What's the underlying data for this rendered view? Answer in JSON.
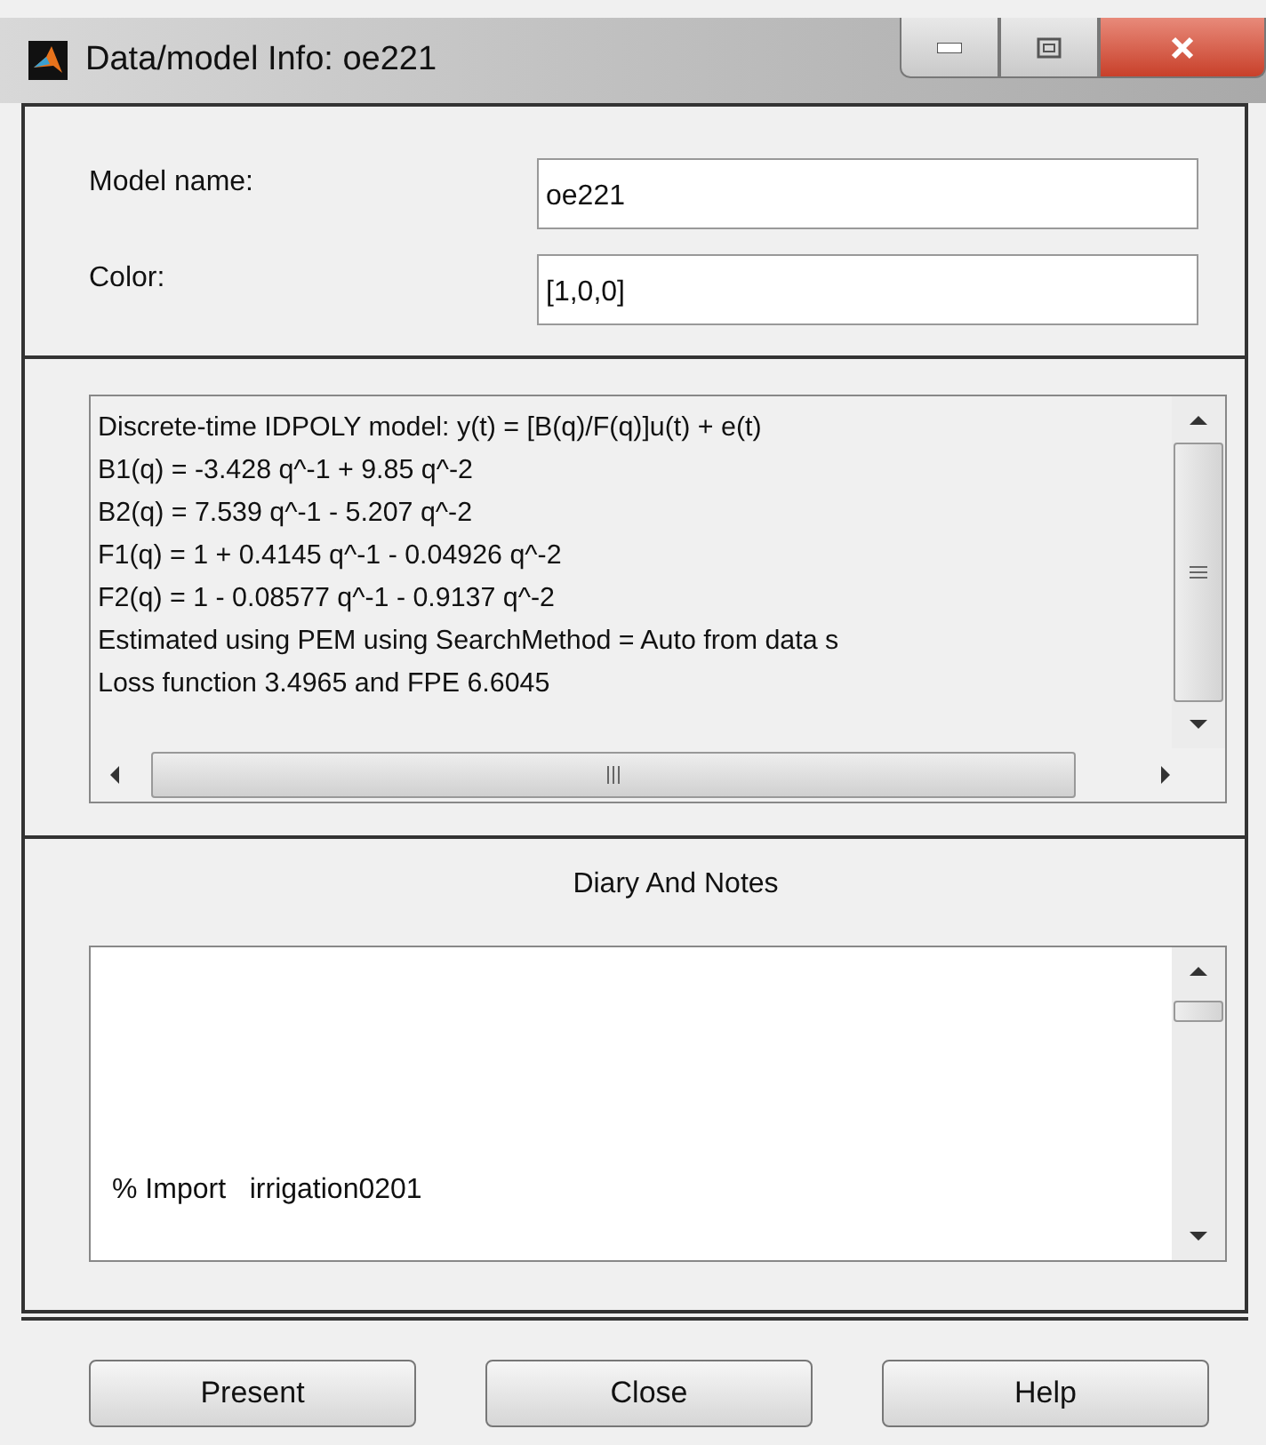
{
  "window": {
    "title": "Data/model Info: oe221"
  },
  "fields": [
    {
      "label": "Model name:",
      "value": "oe221"
    },
    {
      "label": "Color:",
      "value": "[1,0,0]"
    }
  ],
  "info_lines": [
    "Discrete-time IDPOLY model: y(t) = [B(q)/F(q)]u(t) + e(t)",
    "B1(q) = -3.428 q^-1 + 9.85 q^-2",
    "B2(q) = 7.539 q^-1 - 5.207 q^-2",
    "F1(q) = 1 + 0.4145 q^-1 - 0.04926 q^-2",
    "F2(q) = 1 - 0.08577 q^-1 - 0.9137 q^-2",
    "Estimated using PEM using SearchMethod = Auto from data s",
    "Loss function 3.4965 and FPE 6.6045"
  ],
  "notes": {
    "title": "Diary And Notes",
    "text": "% Import   irrigation0201"
  },
  "buttons": [
    "Present",
    "Close",
    "Help"
  ]
}
